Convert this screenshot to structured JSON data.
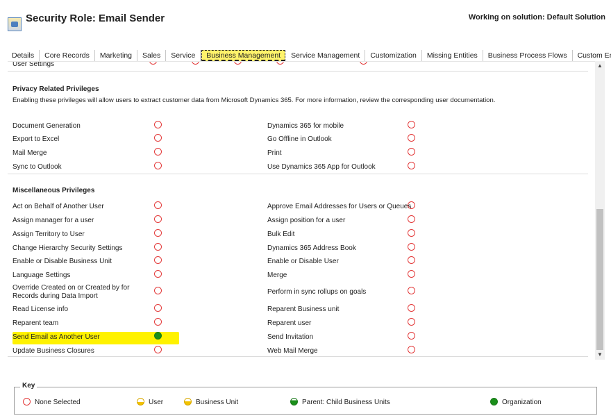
{
  "header": {
    "title": "Security Role: Email Sender",
    "solution": "Working on solution: Default Solution"
  },
  "tabs": [
    {
      "label": "Details",
      "active": false
    },
    {
      "label": "Core Records",
      "active": false
    },
    {
      "label": "Marketing",
      "active": false
    },
    {
      "label": "Sales",
      "active": false
    },
    {
      "label": "Service",
      "active": false
    },
    {
      "label": "Business Management",
      "active": true
    },
    {
      "label": "Service Management",
      "active": false
    },
    {
      "label": "Customization",
      "active": false
    },
    {
      "label": "Missing Entities",
      "active": false
    },
    {
      "label": "Business Process Flows",
      "active": false
    },
    {
      "label": "Custom Entities",
      "active": false
    }
  ],
  "content": {
    "top_partial": "User Settings",
    "privacy": {
      "title": "Privacy Related Privileges",
      "description": "Enabling these privileges will allow users to extract customer data from Microsoft Dynamics 365. For more information, review the corresponding user documentation.",
      "left": [
        {
          "label": "Document Generation",
          "level": "none"
        },
        {
          "label": "Export to Excel",
          "level": "none"
        },
        {
          "label": "Mail Merge",
          "level": "none"
        },
        {
          "label": "Sync to Outlook",
          "level": "none"
        }
      ],
      "right": [
        {
          "label": "Dynamics 365 for mobile",
          "level": "none"
        },
        {
          "label": "Go Offline in Outlook",
          "level": "none"
        },
        {
          "label": "Print",
          "level": "none"
        },
        {
          "label": "Use Dynamics 365 App for Outlook",
          "level": "none"
        }
      ]
    },
    "misc": {
      "title": "Miscellaneous Privileges",
      "left": [
        {
          "label": "Act on Behalf of Another User",
          "level": "none"
        },
        {
          "label": "Assign manager for a user",
          "level": "none"
        },
        {
          "label": "Assign Territory to User",
          "level": "none"
        },
        {
          "label": "Change Hierarchy Security Settings",
          "level": "none"
        },
        {
          "label": "Enable or Disable Business Unit",
          "level": "none"
        },
        {
          "label": "Language Settings",
          "level": "none"
        },
        {
          "label": "Override Created on or Created by for Records during Data Import",
          "level": "none"
        },
        {
          "label": "Read License info",
          "level": "none"
        },
        {
          "label": "Reparent team",
          "level": "none"
        },
        {
          "label": "Send Email as Another User",
          "level": "organization"
        },
        {
          "label": "Update Business Closures",
          "level": "none"
        }
      ],
      "right": [
        {
          "label": "Approve Email Addresses for Users or Queues",
          "level": "none"
        },
        {
          "label": "Assign position for a user",
          "level": "none"
        },
        {
          "label": "Bulk Edit",
          "level": "none"
        },
        {
          "label": "Dynamics 365 Address Book",
          "level": "none"
        },
        {
          "label": "Enable or Disable User",
          "level": "none"
        },
        {
          "label": "Merge",
          "level": "none"
        },
        {
          "label": "Perform in sync rollups on goals",
          "level": "none"
        },
        {
          "label": "Reparent Business unit",
          "level": "none"
        },
        {
          "label": "Reparent user",
          "level": "none"
        },
        {
          "label": "Send Invitation",
          "level": "none"
        },
        {
          "label": "Web Mail Merge",
          "level": "none"
        }
      ]
    }
  },
  "key": {
    "title": "Key",
    "items": [
      {
        "label": "None Selected",
        "icon": "none-selected-icon"
      },
      {
        "label": "User",
        "icon": "user-level-icon"
      },
      {
        "label": "Business Unit",
        "icon": "business-unit-level-icon"
      },
      {
        "label": "Parent: Child Business Units",
        "icon": "parent-child-level-icon"
      },
      {
        "label": "Organization",
        "icon": "organization-level-icon"
      }
    ]
  },
  "colors": {
    "none": "#e33a3a",
    "organization": "#1a8f1a",
    "highlight": "#fff200",
    "tab_active": "#fff36b"
  }
}
